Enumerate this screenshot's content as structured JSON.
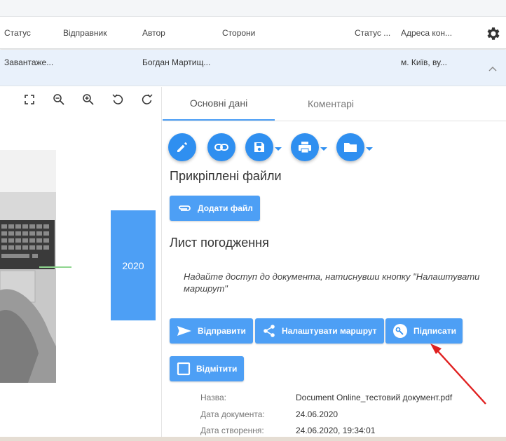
{
  "table": {
    "headers": [
      "Статус",
      "Відправник",
      "Автор",
      "Сторони",
      "Статус ...",
      "Адреса кон..."
    ],
    "row": [
      "Завантаже...",
      "Богдан Мартищ...",
      "м. Київ, ву..."
    ]
  },
  "viewer": {
    "badge_text": "2020"
  },
  "tabs": [
    "Основні дані",
    "Коментарі"
  ],
  "sections": {
    "attached_files": "Прикріплені файли",
    "approval_sheet": "Лист погодження"
  },
  "buttons": {
    "add_file": "Додати файл",
    "send": "Відправити",
    "configure_route": "Налаштувати маршрут",
    "sign": "Підписати",
    "mark": "Відмітити"
  },
  "hint": "Надайте доступ до документа, натиснувши кнопку \"Налаштувати маршрут\"",
  "meta": [
    {
      "label": "Назва:",
      "value": "Document Online_тестовий документ.pdf"
    },
    {
      "label": "Дата документа:",
      "value": "24.06.2020"
    },
    {
      "label": "Дата створення:",
      "value": "24.06.2020, 19:34:01"
    }
  ],
  "icons": [
    "gear-icon",
    "chevron-up-icon",
    "fullscreen-icon",
    "zoom-out-icon",
    "zoom-in-icon",
    "rotate-left-icon",
    "rotate-right-icon",
    "pencil-icon",
    "link-icon",
    "save-icon",
    "print-icon",
    "folder-icon",
    "paperclip-icon",
    "send-icon",
    "share-icon",
    "key-icon",
    "checkbox-icon"
  ],
  "colors": {
    "accent": "#2f8ff0",
    "button": "#4d9ff5",
    "row_highlight": "#e9f1fb",
    "annotation_arrow": "#e02020"
  }
}
